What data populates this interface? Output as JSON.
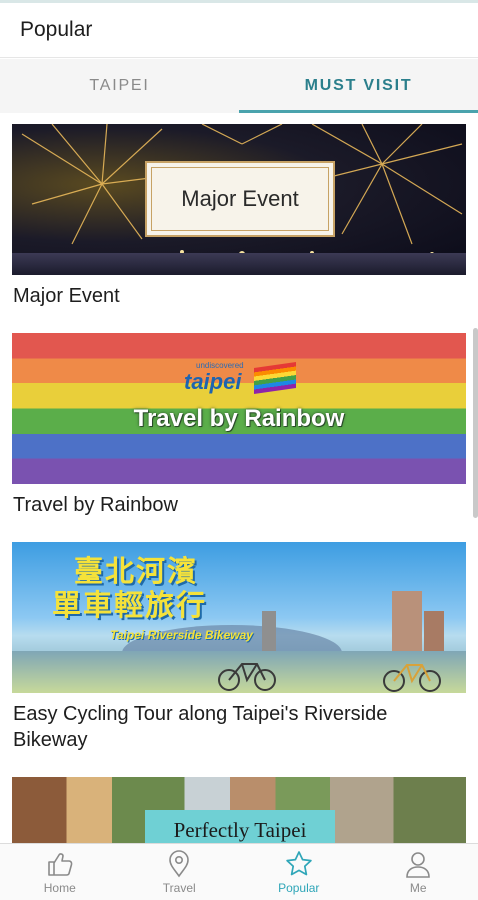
{
  "header": {
    "title": "Popular"
  },
  "tabs": [
    {
      "label": "TAIPEI",
      "active": false
    },
    {
      "label": "MUST VISIT",
      "active": true
    }
  ],
  "cards": [
    {
      "image_text": "Major Event",
      "caption": "Major Event"
    },
    {
      "image_logo_small": "undiscovered",
      "image_logo_big": "taipei",
      "image_text": "Travel by Rainbow",
      "caption": "Travel by Rainbow"
    },
    {
      "image_text_line1": "臺北河濱",
      "image_text_line2": "單車輕旅行",
      "image_subtext": "Taipei Riverside Bikeway",
      "caption": "Easy Cycling Tour along Taipei's Riverside Bikeway"
    },
    {
      "image_text": "Perfectly Taipei"
    }
  ],
  "bottom_nav": [
    {
      "label": "Home",
      "icon": "thumbs-up-icon",
      "active": false
    },
    {
      "label": "Travel",
      "icon": "map-pin-icon",
      "active": false
    },
    {
      "label": "Popular",
      "icon": "star-icon",
      "active": true
    },
    {
      "label": "Me",
      "icon": "user-icon",
      "active": false
    }
  ],
  "colors": {
    "accent": "#2fa6b8",
    "tab_active": "#2b7f8c",
    "inactive": "#8a8a8a"
  }
}
